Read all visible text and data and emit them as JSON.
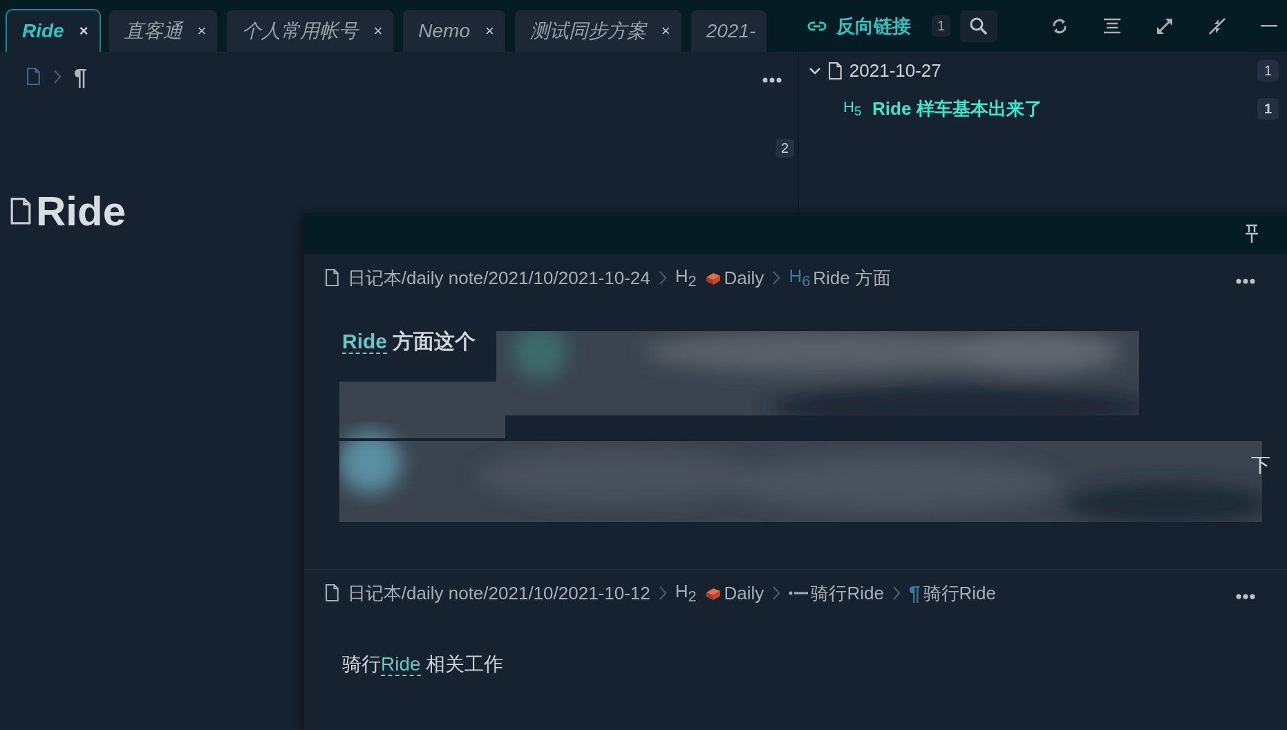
{
  "tabs": [
    {
      "label": "Ride",
      "selected": true,
      "close": "×"
    },
    {
      "label": "直客通",
      "selected": false,
      "close": "×"
    },
    {
      "label": "个人常用帐号",
      "selected": false,
      "close": "×"
    },
    {
      "label": "Nemo",
      "selected": false,
      "close": "×"
    },
    {
      "label": "测试同步方案",
      "selected": false,
      "close": "×"
    },
    {
      "label": "2021-",
      "selected": false
    }
  ],
  "editor": {
    "breadcrumb_mark": "¶",
    "badge": "2",
    "title": "Ride"
  },
  "backlinks": {
    "title": "反向链接",
    "count": "1",
    "files": [
      {
        "name": "2021-10-27",
        "count": "1",
        "expanded": true,
        "children": [
          {
            "level": "H$_{5}$",
            "text": "Ride 样车基本出来了",
            "count": "1"
          }
        ]
      }
    ]
  },
  "popover": {
    "sections": [
      {
        "path": "日记本/daily note/2021/10/2021-10-24",
        "crumbs": [
          {
            "kind": "emoji_heading",
            "level": "H$_{2}$",
            "text": "Daily"
          },
          {
            "kind": "heading",
            "level": "H$_{6}$",
            "text": "Ride 方面"
          }
        ],
        "kind": "blurred",
        "link": "Ride",
        "text": "方面这个",
        "edge_char": "下"
      },
      {
        "path": "日记本/daily note/2021/10/2021-10-12",
        "crumbs": [
          {
            "kind": "emoji_heading",
            "level": "H$_{2}$",
            "text": "Daily"
          },
          {
            "kind": "list",
            "text": "骑行Ride"
          },
          {
            "kind": "paragraph",
            "mark": "¶",
            "text": "骑行Ride"
          }
        ],
        "kind": "plain",
        "before": "骑行",
        "link": "Ride",
        "text": " 相关工作"
      }
    ]
  }
}
